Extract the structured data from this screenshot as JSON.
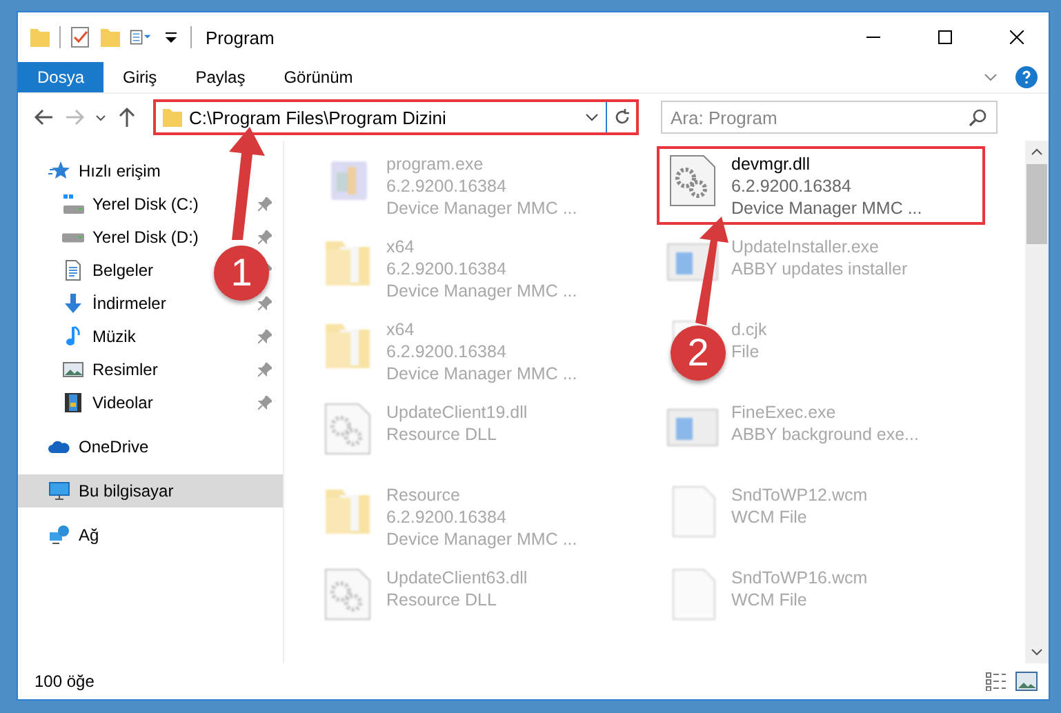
{
  "window": {
    "title": "Program"
  },
  "ribbon_tabs": [
    {
      "label": "Dosya",
      "selected": true
    },
    {
      "label": "Giriş",
      "selected": false
    },
    {
      "label": "Paylaş",
      "selected": false
    },
    {
      "label": "Görünüm",
      "selected": false
    }
  ],
  "address": {
    "path": "C:\\Program Files\\Program Dizini",
    "highlighted": true
  },
  "search": {
    "placeholder": "Ara: Program"
  },
  "sidebar": {
    "items": [
      {
        "label": "Hızlı erişim",
        "selected": false,
        "children": [
          {
            "label": "Yerel Disk (C:)",
            "pinned": true,
            "selected": false
          },
          {
            "label": "Yerel Disk (D:)",
            "pinned": true,
            "selected": false
          },
          {
            "label": "Belgeler",
            "pinned": true,
            "selected": false
          },
          {
            "label": "İndirmeler",
            "pinned": true,
            "selected": false
          },
          {
            "label": "Müzik",
            "pinned": true,
            "selected": false
          },
          {
            "label": "Resimler",
            "pinned": true,
            "selected": false
          },
          {
            "label": "Videolar",
            "pinned": true,
            "selected": false
          }
        ]
      },
      {
        "label": "OneDrive",
        "selected": false
      },
      {
        "label": "Bu bilgisayar",
        "selected": true
      },
      {
        "label": "Ağ",
        "selected": false
      }
    ]
  },
  "files": [
    {
      "kind": "program",
      "name": "program.exe",
      "details": [
        "6.2.9200.16384",
        "Device Manager MMC ..."
      ],
      "blurred": true,
      "highlighted": false
    },
    {
      "kind": "dll",
      "name": "devmgr.dll",
      "details": [
        "6.2.9200.16384",
        "Device Manager MMC ..."
      ],
      "blurred": false,
      "highlighted": true
    },
    {
      "kind": "folder",
      "name": "x64",
      "details": [
        "6.2.9200.16384",
        "Device Manager MMC ..."
      ],
      "blurred": true,
      "highlighted": false
    },
    {
      "kind": "app",
      "name": "UpdateInstaller.exe",
      "details": [
        "ABBY updates installer"
      ],
      "blurred": true,
      "highlighted": false
    },
    {
      "kind": "folder",
      "name": "x64",
      "details": [
        "6.2.9200.16384",
        "Device Manager MMC ..."
      ],
      "blurred": true,
      "highlighted": false
    },
    {
      "kind": "file",
      "name": "d.cjk",
      "details": [
        "File"
      ],
      "blurred": true,
      "highlighted": false
    },
    {
      "kind": "dll",
      "name": "UpdateClient19.dll",
      "details": [
        "Resource DLL"
      ],
      "blurred": true,
      "highlighted": false
    },
    {
      "kind": "app",
      "name": "FineExec.exe",
      "details": [
        "ABBY background exe..."
      ],
      "blurred": true,
      "highlighted": false
    },
    {
      "kind": "folder",
      "name": "Resource",
      "details": [
        "6.2.9200.16384",
        "Device Manager MMC ..."
      ],
      "blurred": true,
      "highlighted": false
    },
    {
      "kind": "file",
      "name": "SndToWP12.wcm",
      "details": [
        "WCM File"
      ],
      "blurred": true,
      "highlighted": false
    },
    {
      "kind": "dll",
      "name": "UpdateClient63.dll",
      "details": [
        "Resource DLL"
      ],
      "blurred": true,
      "highlighted": false
    },
    {
      "kind": "file",
      "name": "SndToWP16.wcm",
      "details": [
        "WCM File"
      ],
      "blurred": true,
      "highlighted": false
    }
  ],
  "status_bar": {
    "count": "100 öğe"
  },
  "callouts": [
    {
      "number": "1"
    },
    {
      "number": "2"
    }
  ]
}
